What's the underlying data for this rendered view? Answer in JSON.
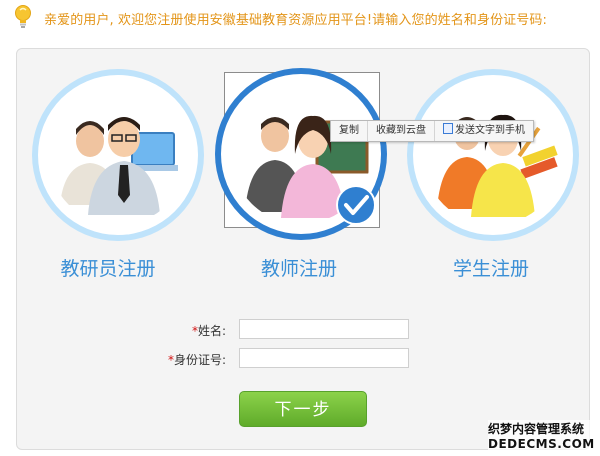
{
  "notice": {
    "text": "亲爱的用户, 欢迎您注册使用安徽基础教育资源应用平台!请输入您的姓名和身份证号码:",
    "icon": "lightbulb-icon"
  },
  "roles": [
    {
      "label": "教研员注册",
      "icon": "researchers-icon"
    },
    {
      "label": "教师注册",
      "icon": "teachers-icon",
      "selected": true
    },
    {
      "label": "学生注册",
      "icon": "students-icon"
    }
  ],
  "context_menu": {
    "items": [
      "复制",
      "收藏到云盘",
      "发送文字到手机"
    ]
  },
  "form": {
    "name_label": "姓名:",
    "id_label": "身份证号:",
    "required_mark": "*",
    "name_value": "",
    "id_value": ""
  },
  "next_button": "下一步",
  "watermark": {
    "line1": "织梦内容管理系统",
    "line2": "DEDECMS.COM"
  },
  "colors": {
    "notice_text": "#e39519",
    "role_label": "#3a8fd6",
    "ring": "#bfe3fb",
    "selected_ring": "#2f7fd0",
    "button": "#6fbd34",
    "required": "#d01010"
  }
}
